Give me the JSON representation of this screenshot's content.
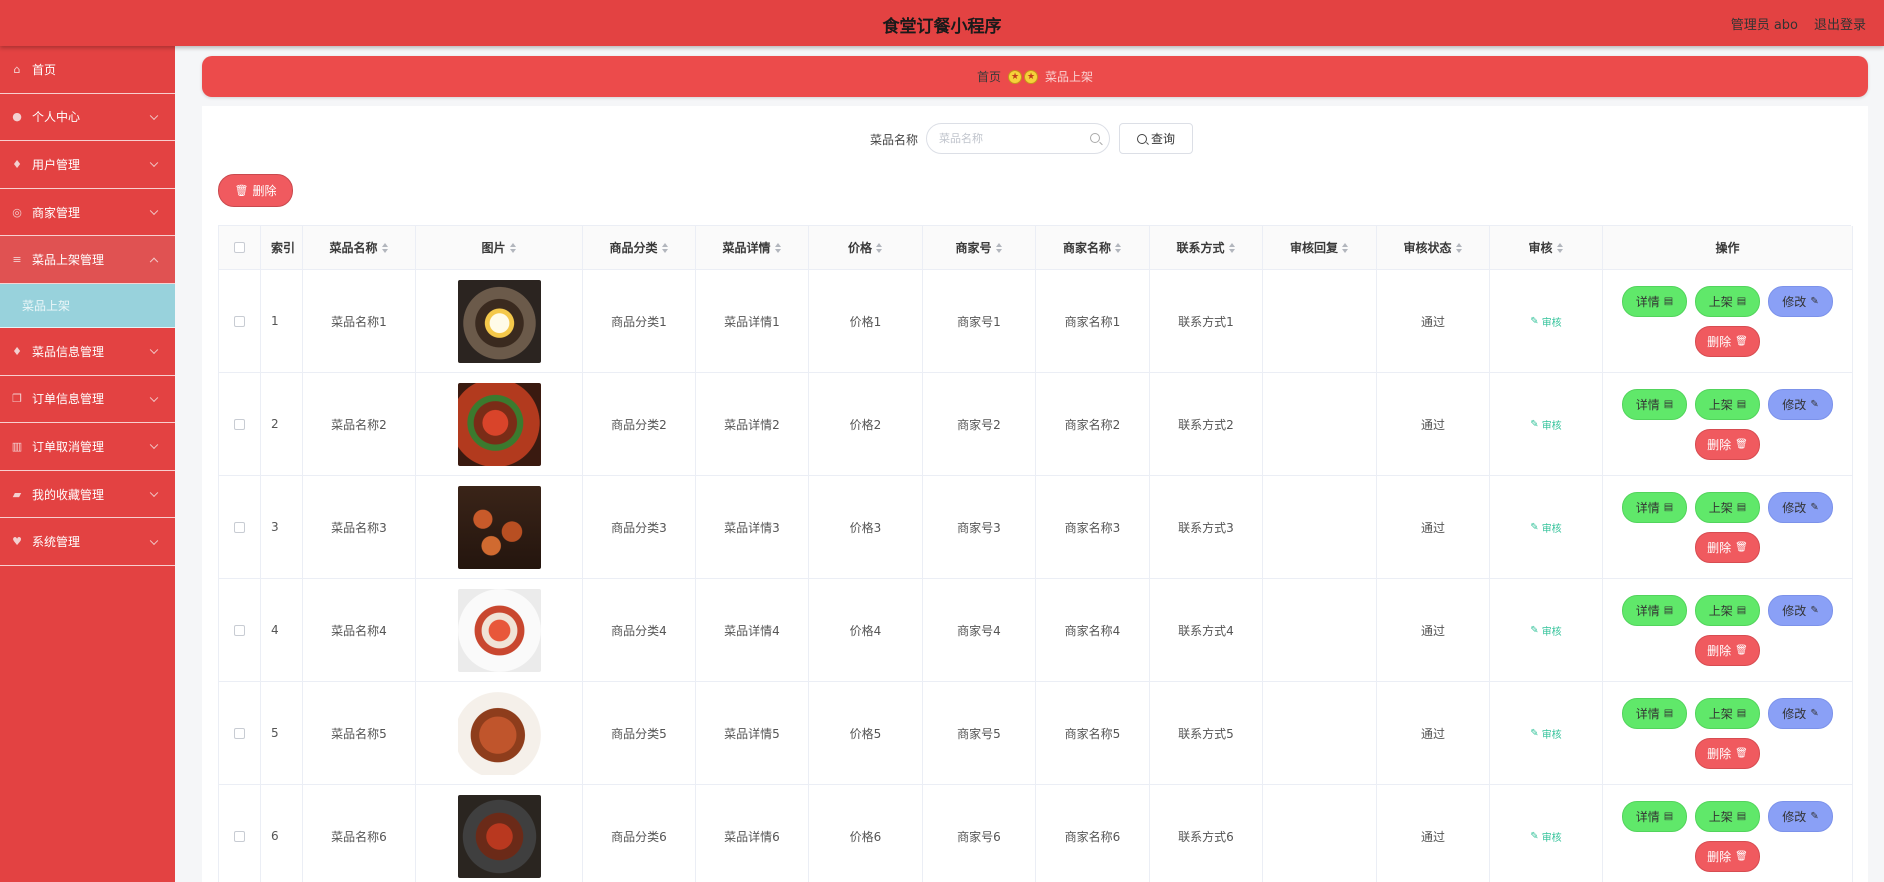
{
  "header": {
    "title": "食堂订餐小程序",
    "admin_label": "管理员 abo",
    "logout_label": "退出登录"
  },
  "sidebar": {
    "items": [
      {
        "label": "首页",
        "icon": "home-icon",
        "has_chevron": false
      },
      {
        "label": "个人中心",
        "icon": "user-icon",
        "has_chevron": true
      },
      {
        "label": "用户管理",
        "icon": "mic-icon",
        "has_chevron": true
      },
      {
        "label": "商家管理",
        "icon": "gauge-icon",
        "has_chevron": true
      },
      {
        "label": "菜品上架管理",
        "icon": "list-icon",
        "has_chevron": true,
        "expanded": true
      },
      {
        "label": "菜品信息管理",
        "icon": "mic-icon",
        "has_chevron": true
      },
      {
        "label": "订单信息管理",
        "icon": "copy-icon",
        "has_chevron": true
      },
      {
        "label": "订单取消管理",
        "icon": "trash-icon",
        "has_chevron": true
      },
      {
        "label": "我的收藏管理",
        "icon": "folder-icon",
        "has_chevron": true
      },
      {
        "label": "系统管理",
        "icon": "shield-icon",
        "has_chevron": true
      }
    ],
    "sub_item": "菜品上架"
  },
  "breadcrumb": {
    "home": "首页",
    "current": "菜品上架"
  },
  "search": {
    "label": "菜品名称",
    "placeholder": "菜品名称",
    "button_label": "查询"
  },
  "toolbar": {
    "delete_label": "删除"
  },
  "table": {
    "columns": [
      "索引",
      "菜品名称",
      "图片",
      "商品分类",
      "菜品详情",
      "价格",
      "商家号",
      "商家名称",
      "联系方式",
      "审核回复",
      "审核状态",
      "审核",
      "操作"
    ],
    "audit_link": "审核",
    "actions": {
      "detail": "详情",
      "shelf": "上架",
      "edit": "修改",
      "delete": "删除"
    },
    "rows": [
      {
        "index": "1",
        "name": "菜品名称1",
        "category": "商品分类1",
        "detail": "菜品详情1",
        "price": "价格1",
        "merchant_no": "商家号1",
        "merchant_name": "商家名称1",
        "contact": "联系方式1",
        "reply": "",
        "status": "通过"
      },
      {
        "index": "2",
        "name": "菜品名称2",
        "category": "商品分类2",
        "detail": "菜品详情2",
        "price": "价格2",
        "merchant_no": "商家号2",
        "merchant_name": "商家名称2",
        "contact": "联系方式2",
        "reply": "",
        "status": "通过"
      },
      {
        "index": "3",
        "name": "菜品名称3",
        "category": "商品分类3",
        "detail": "菜品详情3",
        "price": "价格3",
        "merchant_no": "商家号3",
        "merchant_name": "商家名称3",
        "contact": "联系方式3",
        "reply": "",
        "status": "通过"
      },
      {
        "index": "4",
        "name": "菜品名称4",
        "category": "商品分类4",
        "detail": "菜品详情4",
        "price": "价格4",
        "merchant_no": "商家号4",
        "merchant_name": "商家名称4",
        "contact": "联系方式4",
        "reply": "",
        "status": "通过"
      },
      {
        "index": "5",
        "name": "菜品名称5",
        "category": "商品分类5",
        "detail": "菜品详情5",
        "price": "价格5",
        "merchant_no": "商家号5",
        "merchant_name": "商家名称5",
        "contact": "联系方式5",
        "reply": "",
        "status": "通过"
      },
      {
        "index": "6",
        "name": "菜品名称6",
        "category": "商品分类6",
        "detail": "菜品详情6",
        "price": "价格6",
        "merchant_no": "商家号6",
        "merchant_name": "商家名称6",
        "contact": "联系方式6",
        "reply": "",
        "status": "通过"
      }
    ]
  },
  "colors": {
    "brand_red": "#e34242",
    "active_sub_bg": "#98d2dc",
    "btn_green": "#60e86a",
    "btn_blue": "#8aa0f6",
    "btn_red": "#f05a5f",
    "audit_link": "#35c39b"
  }
}
